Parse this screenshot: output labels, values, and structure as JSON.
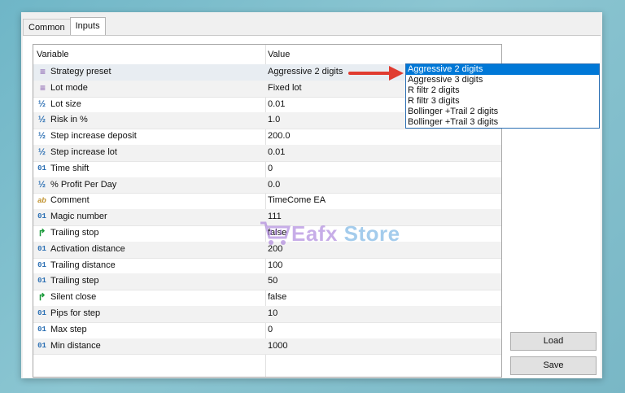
{
  "tabs": [
    {
      "label": "Common",
      "active": false
    },
    {
      "label": "Inputs",
      "active": true
    }
  ],
  "table": {
    "headers": {
      "variable": "Variable",
      "value": "Value"
    },
    "rows": [
      {
        "icon": "enum-icon",
        "glyph": "≡",
        "type": "t-enum",
        "name": "Strategy preset",
        "value": "Aggressive 2 digits"
      },
      {
        "icon": "enum-icon",
        "glyph": "≡",
        "type": "t-enum",
        "name": "Lot mode",
        "value": "Fixed lot"
      },
      {
        "icon": "double-icon",
        "glyph": "½",
        "type": "t-frac",
        "name": "Lot size",
        "value": "0.01"
      },
      {
        "icon": "double-icon",
        "glyph": "½",
        "type": "t-frac",
        "name": "Risk in %",
        "value": "1.0"
      },
      {
        "icon": "double-icon",
        "glyph": "½",
        "type": "t-frac",
        "name": "Step increase deposit",
        "value": "200.0"
      },
      {
        "icon": "double-icon",
        "glyph": "½",
        "type": "t-frac",
        "name": "Step increase lot",
        "value": "0.01"
      },
      {
        "icon": "integer-icon",
        "glyph": "01",
        "type": "t-int",
        "name": "Time shift",
        "value": "0"
      },
      {
        "icon": "double-icon",
        "glyph": "½",
        "type": "t-frac",
        "name": "% Profit Per Day",
        "value": "0.0"
      },
      {
        "icon": "string-icon",
        "glyph": "ab",
        "type": "t-str",
        "name": "Comment",
        "value": "TimeCome EA"
      },
      {
        "icon": "integer-icon",
        "glyph": "01",
        "type": "t-int",
        "name": "Magic number",
        "value": "111"
      },
      {
        "icon": "bool-icon",
        "glyph": "↱",
        "type": "t-bool",
        "name": "Trailing stop",
        "value": "false"
      },
      {
        "icon": "integer-icon",
        "glyph": "01",
        "type": "t-int",
        "name": "Activation distance",
        "value": "200"
      },
      {
        "icon": "integer-icon",
        "glyph": "01",
        "type": "t-int",
        "name": "Trailing distance",
        "value": "100"
      },
      {
        "icon": "integer-icon",
        "glyph": "01",
        "type": "t-int",
        "name": "Trailing step",
        "value": "50"
      },
      {
        "icon": "bool-icon",
        "glyph": "↱",
        "type": "t-bool",
        "name": "Silent close",
        "value": "false"
      },
      {
        "icon": "integer-icon",
        "glyph": "01",
        "type": "t-int",
        "name": "Pips for step",
        "value": "10"
      },
      {
        "icon": "integer-icon",
        "glyph": "01",
        "type": "t-int",
        "name": "Max step",
        "value": "0"
      },
      {
        "icon": "integer-icon",
        "glyph": "01",
        "type": "t-int",
        "name": "Min distance",
        "value": "1000"
      }
    ]
  },
  "dropdown": {
    "options": [
      "Aggressive 2 digits",
      "Aggressive 3 digits",
      "R filtr 2 digits",
      "R filtr 3 digits",
      "Bollinger +Trail 2 digits",
      "Bollinger +Trail 3 digits"
    ],
    "selected_index": 0
  },
  "buttons": {
    "load": "Load",
    "save": "Save"
  },
  "watermark": {
    "part1": "Eafx",
    "part2": "Store"
  },
  "colors": {
    "arrow": "#e03c31",
    "selection": "#0078d7",
    "accent": "#2b6fb3"
  }
}
